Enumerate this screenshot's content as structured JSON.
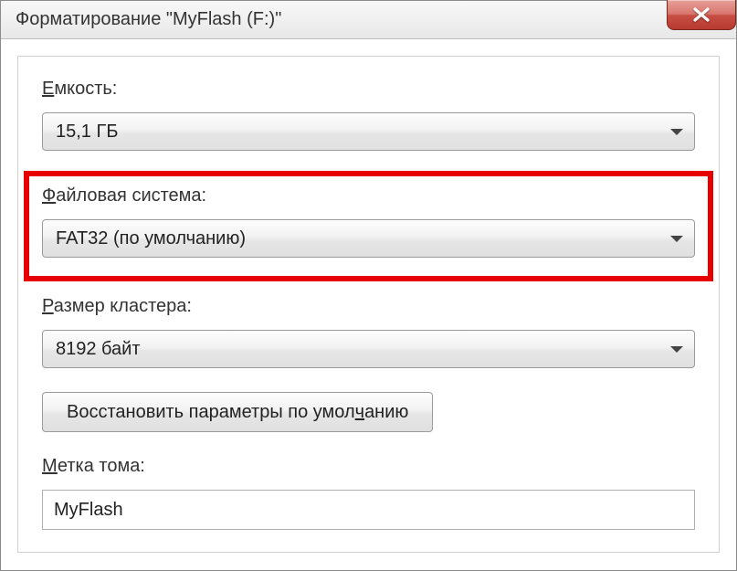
{
  "window": {
    "title": "Форматирование \"MyFlash (F:)\""
  },
  "capacity": {
    "label_pre": "Е",
    "label_rest": "мкость:",
    "value": "15,1 ГБ"
  },
  "filesystem": {
    "label_pre": "Ф",
    "label_rest": "айловая система:",
    "value": "FAT32 (по умолчанию)"
  },
  "cluster": {
    "label_pre": "Р",
    "label_rest": "азмер кластера:",
    "value": "8192 байт"
  },
  "restore_button": {
    "pre": "Восстановить параметры по умол",
    "underline": "ч",
    "post": "анию"
  },
  "volume_label": {
    "label_pre": "М",
    "label_rest": "етка тома:",
    "value": "MyFlash"
  }
}
